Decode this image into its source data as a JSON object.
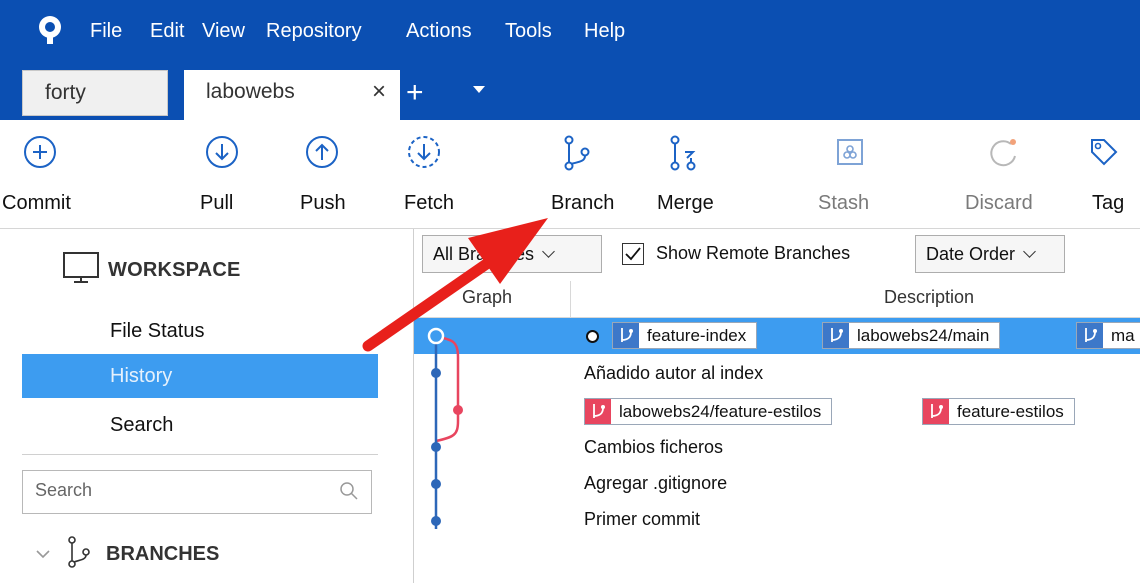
{
  "menu": {
    "items": [
      "File",
      "Edit",
      "View",
      "Repository",
      "Actions",
      "Tools",
      "Help"
    ]
  },
  "tabs": {
    "items": [
      {
        "label": "forty"
      },
      {
        "label": "labowebs",
        "close": "×"
      }
    ],
    "new_tab": "+"
  },
  "toolbar": {
    "commit": "Commit",
    "pull": "Pull",
    "push": "Push",
    "fetch": "Fetch",
    "branch": "Branch",
    "merge": "Merge",
    "stash": "Stash",
    "discard": "Discard",
    "tag": "Tag"
  },
  "sidebar": {
    "workspace": "WORKSPACE",
    "items": [
      {
        "label": "File Status"
      },
      {
        "label": "History"
      },
      {
        "label": "Search"
      }
    ],
    "search_placeholder": "Search",
    "branches": "BRANCHES"
  },
  "main": {
    "branch_filter": "All Branches",
    "show_remote_label": "Show Remote Branches",
    "order": "Date Order",
    "columns": {
      "graph": "Graph",
      "description": "Description"
    },
    "rows": [
      {
        "description": "",
        "tags": [
          "feature-index",
          "labowebs24/main",
          "ma"
        ]
      },
      {
        "description": "Añadido autor al index"
      },
      {
        "description": "",
        "tags": [
          "labowebs24/feature-estilos",
          "feature-estilos"
        ]
      },
      {
        "description": "Cambios ficheros"
      },
      {
        "description": "Agregar .gitignore"
      },
      {
        "description": "Primer commit"
      }
    ]
  },
  "colors": {
    "menubar": "#0b4fb2",
    "selection": "#3d9cf0",
    "tag_blue": "#3d78c9",
    "tag_red": "#e8455f",
    "arrow": "#e8201b"
  }
}
